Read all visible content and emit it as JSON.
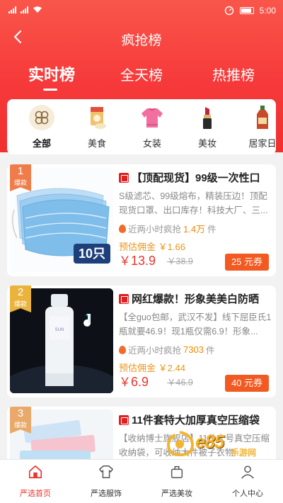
{
  "status_bar": {
    "time": "5:00"
  },
  "header": {
    "title": "疯抢榜"
  },
  "tabs": [
    {
      "label": "实时榜",
      "active": true
    },
    {
      "label": "全天榜",
      "active": false
    },
    {
      "label": "热推榜",
      "active": false
    }
  ],
  "categories": [
    {
      "label": "全部",
      "icon": "all-grid-icon",
      "active": true
    },
    {
      "label": "美食",
      "icon": "snack-bag-icon",
      "active": false
    },
    {
      "label": "女装",
      "icon": "sweater-icon",
      "active": false
    },
    {
      "label": "美妆",
      "icon": "lipstick-icon",
      "active": false
    },
    {
      "label": "居家日",
      "icon": "bottle-icon",
      "active": false
    }
  ],
  "products": [
    {
      "rank": "1",
      "rank_tag": "爆款",
      "title": "【顶配现货】99级一次性口",
      "desc": "S级滤芯、99级熔布，精装压边！顶配现货口罩、出口库存！科技大厂、三...",
      "sales_label": "近两小时疯抢",
      "sales_count": "1.4万",
      "sales_unit": "件",
      "commission_label": "预估佣金",
      "commission": "￥1.66",
      "price_symbol": "￥",
      "price": "13.9",
      "old_price": "￥38.9",
      "coupon": "25 元券",
      "image_badge": "10只",
      "rank_color": "#f07c4a"
    },
    {
      "rank": "2",
      "rank_tag": "爆款",
      "title": "网红爆款！形象美美白防晒",
      "desc": "【全guo包邮，武汉不发】线下屈臣氏1瓶就要46.9！现1瓶仅需6.9！形象...",
      "sales_label": "近两小时疯抢",
      "sales_count": "7303",
      "sales_unit": "件",
      "commission_label": "预估佣金",
      "commission": "￥2.44",
      "price_symbol": "￥",
      "price": "6.9",
      "old_price": "￥46.9",
      "coupon": "40 元券",
      "image_badge": "",
      "rank_color": "#e9b33c"
    },
    {
      "rank": "3",
      "rank_tag": "爆款",
      "title": "11件套特大加厚真空压缩袋",
      "desc": "【收纳博士旗舰店】11件大号真空压缩收纳袋，可收纳大件被子衣物...",
      "sales_label": "",
      "sales_count": "",
      "sales_unit": "",
      "commission_label": "",
      "commission": "",
      "price_symbol": "",
      "price": "",
      "old_price": "",
      "coupon": "",
      "image_badge": "",
      "rank_color": "#e9a96a"
    }
  ],
  "bottom_nav": [
    {
      "label": "严选首页",
      "icon": "home-icon",
      "active": true
    },
    {
      "label": "严选服饰",
      "icon": "shirt-icon",
      "active": false
    },
    {
      "label": "严选美妆",
      "icon": "makeup-icon",
      "active": false
    },
    {
      "label": "个人中心",
      "icon": "user-icon",
      "active": false
    }
  ],
  "watermark": {
    "text": "e85",
    "sub": "手游网"
  },
  "colors": {
    "header_red": "#f6393a",
    "price_red": "#e8352f",
    "coupon_orange": "#f25a22",
    "commission_orange": "#e9951b"
  }
}
